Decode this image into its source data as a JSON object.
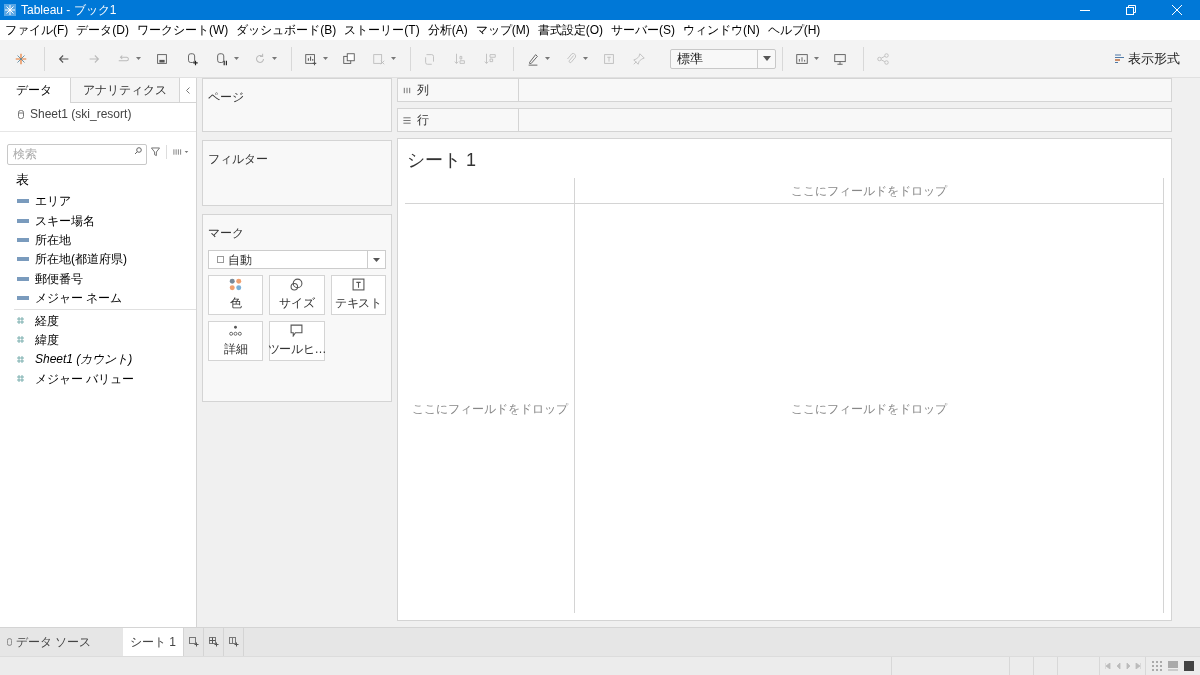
{
  "window": {
    "title": "Tableau - ブック1"
  },
  "menu": [
    "ファイル(F)",
    "データ(D)",
    "ワークシート(W)",
    "ダッシュボード(B)",
    "ストーリー(T)",
    "分析(A)",
    "マップ(M)",
    "書式設定(O)",
    "サーバー(S)",
    "ウィンドウ(N)",
    "ヘルプ(H)"
  ],
  "toolbar": {
    "fit_dropdown": "標準",
    "show_me": "表示形式"
  },
  "data_pane": {
    "tabs": [
      {
        "label": "データ",
        "selected": true
      },
      {
        "label": "アナリティクス",
        "selected": false
      }
    ],
    "datasource": "Sheet1 (ski_resort)",
    "search": {
      "placeholder": "検索"
    },
    "section": "表",
    "fields": [
      {
        "name": "エリア",
        "kind": "dimension",
        "italic": false
      },
      {
        "name": "スキー場名",
        "kind": "dimension",
        "italic": false
      },
      {
        "name": "所在地",
        "kind": "dimension",
        "italic": false
      },
      {
        "name": "所在地(都道府県)",
        "kind": "dimension",
        "italic": false
      },
      {
        "name": "郵便番号",
        "kind": "dimension",
        "italic": false
      },
      {
        "name": "メジャー ネーム",
        "kind": "dimension",
        "italic": false
      },
      {
        "name": "経度",
        "kind": "measure",
        "italic": false
      },
      {
        "name": "緯度",
        "kind": "measure",
        "italic": false
      },
      {
        "name": "Sheet1 (カウント)",
        "kind": "measure",
        "italic": true
      },
      {
        "name": "メジャー バリュー",
        "kind": "measure",
        "italic": false
      }
    ]
  },
  "cards": {
    "pages": "ページ",
    "filters": "フィルター",
    "marks": {
      "title": "マーク",
      "type": "自動",
      "buttons": [
        {
          "label": "色",
          "kind": "color"
        },
        {
          "label": "サイズ",
          "kind": "size"
        },
        {
          "label": "テキスト",
          "kind": "text"
        },
        {
          "label": "詳細",
          "kind": "detail"
        },
        {
          "label": "ツールヒ…",
          "kind": "tooltip"
        }
      ]
    }
  },
  "shelves": [
    {
      "label": "列",
      "kind": "columns"
    },
    {
      "label": "行",
      "kind": "rows"
    }
  ],
  "sheet": {
    "title": "シート 1",
    "drop_top": "ここにフィールドをドロップ",
    "drop_left": "ここにフィールドをドロップ",
    "drop_center": "ここにフィールドをドロップ"
  },
  "sheet_tabs": [
    {
      "label": "データ ソース",
      "kind": "datasource",
      "selected": false
    },
    {
      "label": "シート 1",
      "kind": "sheet",
      "selected": true
    }
  ]
}
